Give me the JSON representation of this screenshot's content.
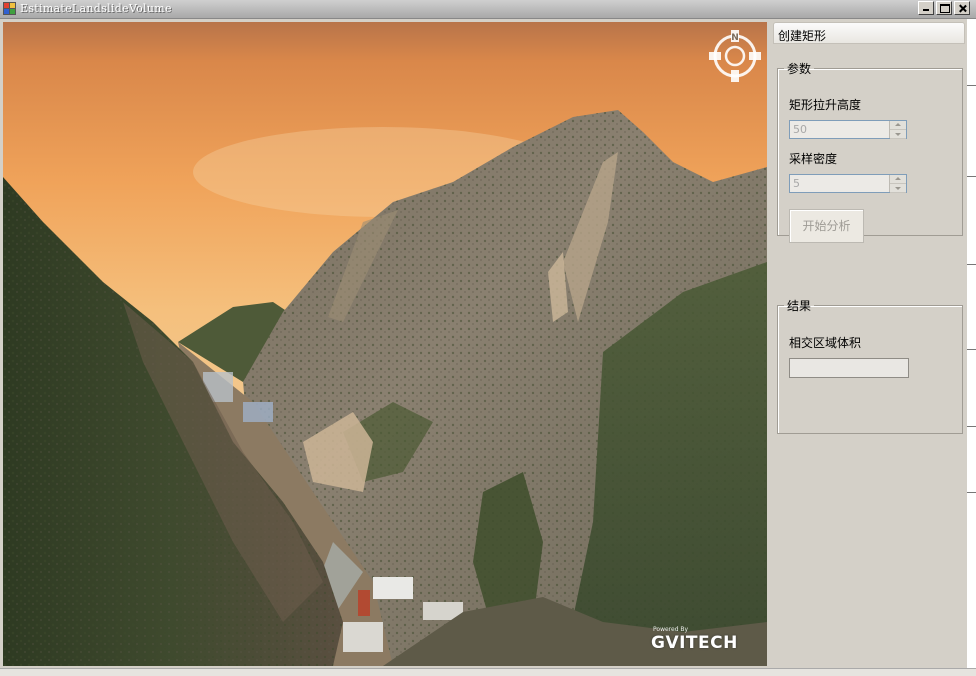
{
  "window": {
    "title": "EstimateLandslideVolume"
  },
  "panel": {
    "tab_label": "创建矩形",
    "params_group": {
      "legend": "参数",
      "height_label": "矩形拉升高度",
      "height_value": "50",
      "density_label": "采样密度",
      "density_value": "5",
      "analyze_button": "开始分析"
    },
    "results_group": {
      "legend": "结果",
      "volume_label": "相交区域体积",
      "volume_value": ""
    }
  },
  "viewport": {
    "compass_letter": "N",
    "logo_powered": "Powered By",
    "logo_brand": "GVITECH"
  }
}
